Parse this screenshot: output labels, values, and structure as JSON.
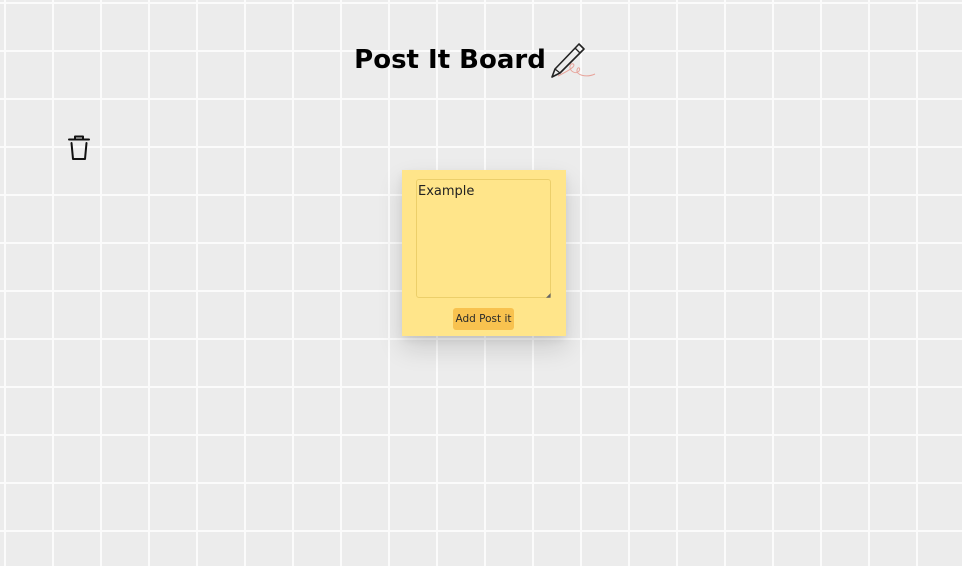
{
  "app": {
    "title": "Post It Board"
  },
  "toolbar": {
    "trash_icon": "trash-icon",
    "pencil_icon": "pencil-icon"
  },
  "note": {
    "text_value": "Example",
    "add_button_label": "Add Post it"
  },
  "colors": {
    "board_background": "#ececec",
    "grid_lines": "#fbfbfb",
    "note_yellow": "#ffe58a",
    "button_orange": "#f8c24f"
  }
}
